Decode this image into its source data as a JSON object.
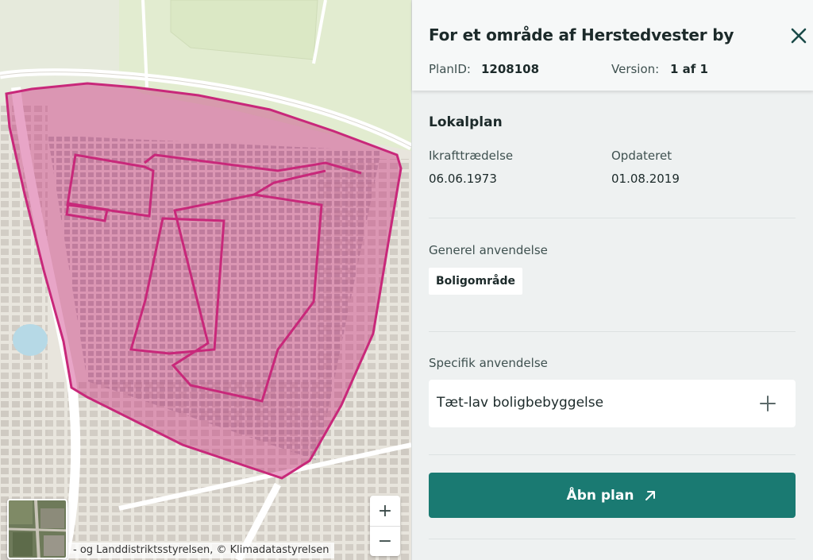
{
  "panel": {
    "title": "For et område af Herstedvester by",
    "plan_id_label": "PlanID:",
    "plan_id": "1208108",
    "version_label": "Version:",
    "version": "1 af 1",
    "section_title": "Lokalplan",
    "effective_label": "Ikrafttrædelse",
    "effective_date": "06.06.1973",
    "updated_label": "Opdateret",
    "updated_date": "01.08.2019",
    "general_use_label": "Generel anvendelse",
    "general_use_value": "Boligområde",
    "specific_use_label": "Specifik anvendelse",
    "specific_use_value": "Tæt-lav boligbebyggelse",
    "open_button_label": "Åbn plan"
  },
  "map": {
    "attribution": "- og Landdistriktsstyrelsen, © Klimadatastyrelsen",
    "zoom_in": "+",
    "zoom_out": "−",
    "highlight_color": "#c8287a"
  },
  "icons": {
    "close": "close-icon",
    "plus": "plus-icon",
    "external": "external-link-icon"
  }
}
